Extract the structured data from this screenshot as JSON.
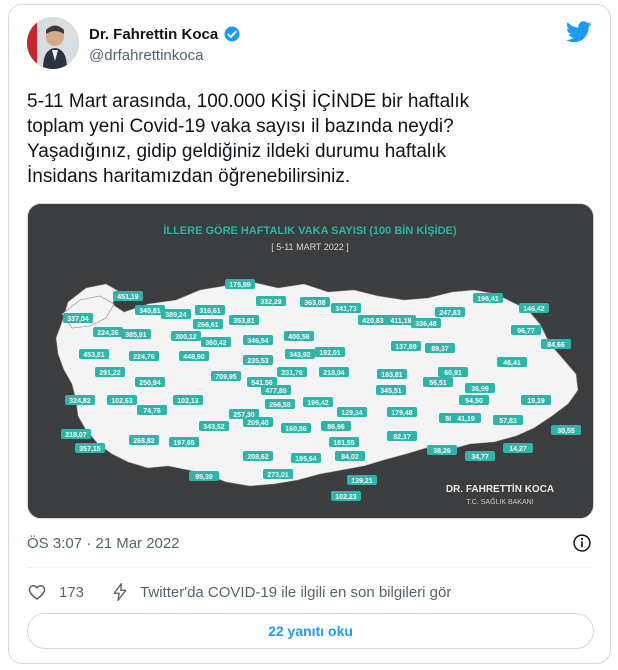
{
  "author": {
    "name": "Dr. Fahrettin Koca",
    "handle": "@drfahrettinkoca"
  },
  "tweet": {
    "lines": [
      "5-11 Mart arasında, 100.000 KİŞİ İÇİNDE bir haftalık",
      "toplam yeni Covid-19 vaka sayısı il bazında neydi?",
      "Yaşadığınız, gidip geldiğiniz ildeki durumu haftalık",
      "İnsidans haritamızdan öğrenebilirsiniz."
    ],
    "timestamp": "ÖS 3:07 · 21 Mar 2022"
  },
  "map": {
    "title": "İLLERE GÖRE HAFTALIK VAKA SAYISI (100 BİN KİŞİDE)",
    "subtitle": "[ 5-11 MART 2022 ]",
    "signature_name": "DR. FAHRETTİN KOCA",
    "signature_title": "T.C. SAĞLIK BAKANI",
    "values": [
      "451,19",
      "337,04",
      "224,36",
      "340,81",
      "389,24",
      "316,61",
      "175,99",
      "332,29",
      "363,08",
      "341,73",
      "420,83",
      "411,19",
      "336,48",
      "247,83",
      "196,41",
      "146,42",
      "385,91",
      "200,12",
      "266,61",
      "353,81",
      "360,42",
      "346,54",
      "400,58",
      "192,01",
      "137,89",
      "89,37",
      "96,77",
      "84,66",
      "453,81",
      "224,76",
      "448,90",
      "235,53",
      "343,92",
      "218,04",
      "183,81",
      "60,91",
      "46,41",
      "291,22",
      "709,95",
      "541,56",
      "231,78",
      "345,51",
      "56,51",
      "36,99",
      "250,94",
      "477,89",
      "19,19",
      "324,82",
      "102,63",
      "102,13",
      "74,76",
      "266,58",
      "196,42",
      "129,34",
      "179,48",
      "54,50",
      "30,55",
      "343,52",
      "209,40",
      "257,30",
      "160,56",
      "86,96",
      "88,09",
      "41,19",
      "57,83",
      "218,07",
      "357,15",
      "268,82",
      "197,65",
      "195,64",
      "181,55",
      "82,17",
      "38,26",
      "34,77",
      "14,27",
      "208,62",
      "273,01",
      "84,02",
      "95,39",
      "139,21",
      "102,23"
    ]
  },
  "stats": {
    "likes": "173",
    "covid_link": "Twitter'da COVID-19 ile ilgili en son bilgileri gör"
  },
  "replies_label": "22 yanıtı oku",
  "colors": {
    "accent": "#1d9bf0",
    "map_bg": "#3c3d3e",
    "map_fill": "#f4f4f4",
    "badge": "#2cb5a8"
  }
}
